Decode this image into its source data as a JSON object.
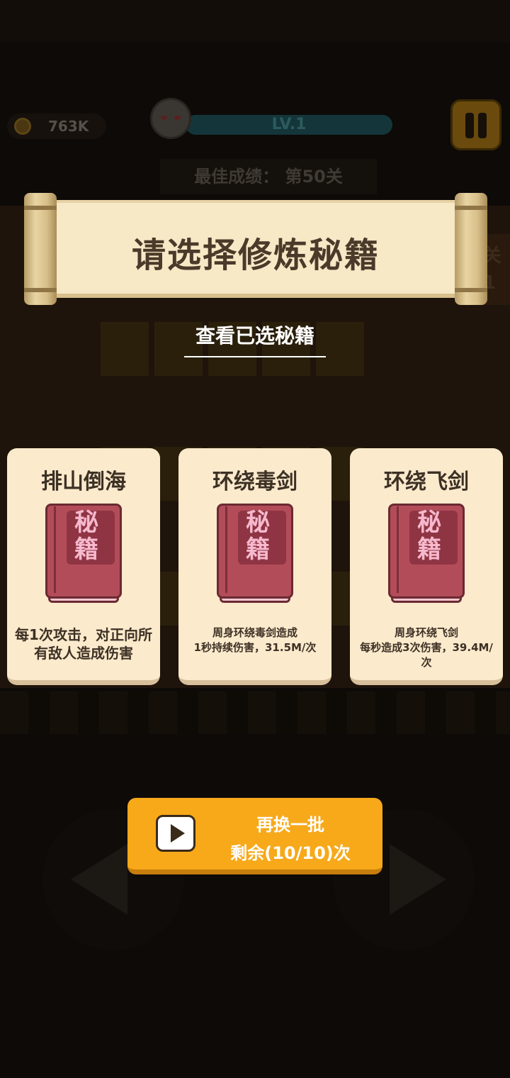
{
  "hud": {
    "coins": "763K",
    "level": "LV.1",
    "best_score": "最佳成绩： 第50关",
    "side_text_top": "关",
    "side_text_bottom": "1"
  },
  "dialog": {
    "title": "请选择修炼秘籍",
    "view_selected": "查看已选秘籍"
  },
  "book_icon_text": {
    "line1": "秘",
    "line2": "籍"
  },
  "cards": [
    {
      "title": "排山倒海",
      "description": "每1次攻击，对正向所有敌人造成伤害"
    },
    {
      "title": "环绕毒剑",
      "description_line1": "周身环绕毒剑造成",
      "description_line2": "1秒持续伤害，31.5M/次"
    },
    {
      "title": "环绕飞剑",
      "description_line1": "周身环绕飞剑",
      "description_line2": "每秒造成3次伤害，39.4M/次"
    }
  ],
  "refresh": {
    "label": "再换一批",
    "remaining": "剩余(10/10)次"
  },
  "colors": {
    "card_bg": "#fbeacc",
    "book_red": "#b34c59",
    "button_orange": "#f7a91a",
    "scroll_paper": "#f7e8c6"
  }
}
